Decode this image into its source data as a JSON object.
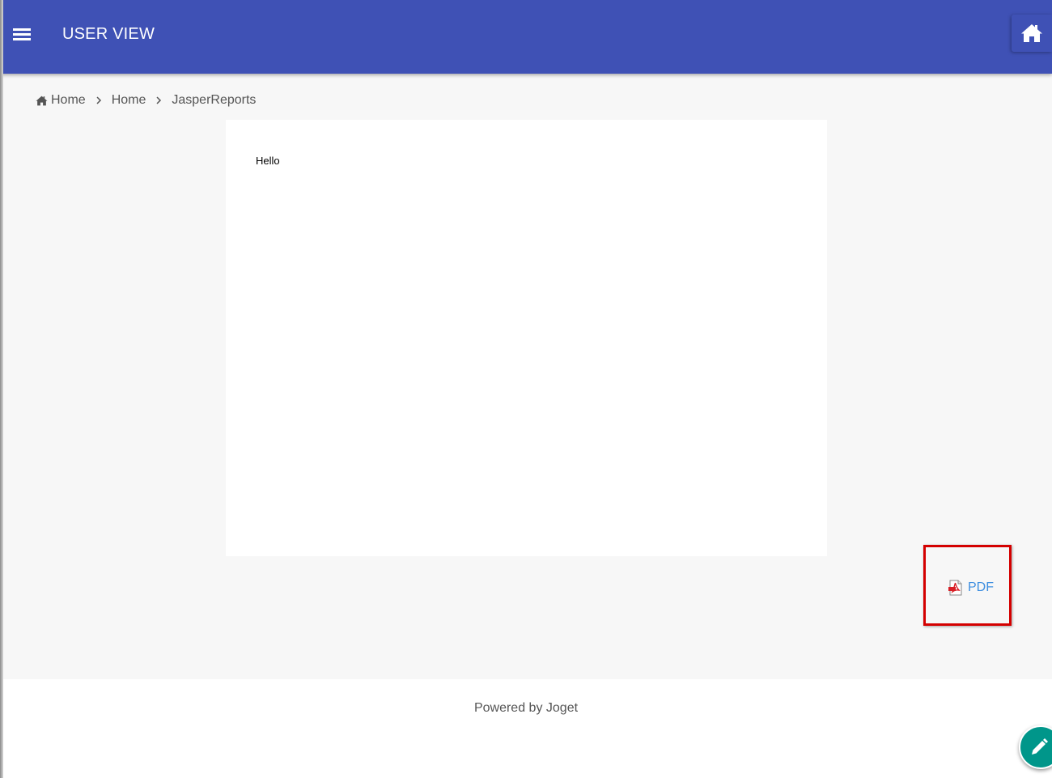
{
  "header": {
    "title": "USER VIEW",
    "menu_icon": "hamburger-menu-icon",
    "home_icon": "home-icon"
  },
  "breadcrumb": {
    "items": [
      "Home",
      "Home",
      "JasperReports"
    ]
  },
  "report": {
    "text": "Hello"
  },
  "export": {
    "pdf_label": "PDF",
    "pdf_icon": "pdf-file-icon"
  },
  "footer": {
    "powered_by": "Powered by Joget",
    "edit_icon": "pencil-icon"
  },
  "colors": {
    "header_bg": "#3f51b5",
    "link": "#3f8fe0",
    "highlight_border": "#d40000",
    "fab_bg": "#00968a"
  }
}
